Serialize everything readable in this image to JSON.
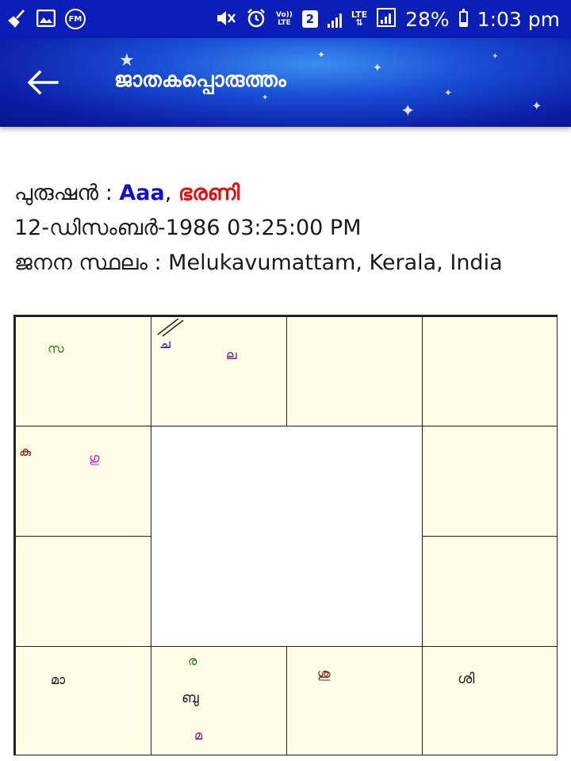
{
  "status_bar": {
    "icons_left": [
      "broom-icon",
      "image-icon",
      "fm-radio-icon"
    ],
    "fm_label": "FM",
    "icons_right": [
      "mute-icon",
      "alarm-icon",
      "volte-icon",
      "sim-icon",
      "signal-icon",
      "lte-icon",
      "signal-icon",
      "battery-icon"
    ],
    "volte_top": "Vo))",
    "volte_bottom": "LTE",
    "sim_number": "2",
    "lte_label": "LTE",
    "battery_percent": "28%",
    "battery_level": 0.28,
    "time": "1:03 pm"
  },
  "app_bar": {
    "back_icon": "arrow-left-icon",
    "title": "ജാതകപ്പൊരുത്തം"
  },
  "profile": {
    "name_label": "പുരുഷൻ : ",
    "name": "Aaa",
    "separator": ", ",
    "star": "ഭരണി",
    "datetime": "12-ഡിസംബർ-1986 03:25:00 PM",
    "birthplace_label": "ജനന സ്ഥലം : ",
    "birthplace": "Melukavumattam, Kerala, India"
  },
  "chart": {
    "cells": {
      "r1c1": [
        {
          "text": "സ",
          "color": "#2e7d32"
        }
      ],
      "r1c2": [
        {
          "text": "ച",
          "color": "#1010d0"
        },
        {
          "text": "ല",
          "color": "#7b1fa2"
        }
      ],
      "r1c3": [],
      "r1c4": [],
      "r2c1": [
        {
          "text": "കു",
          "color": "#8b1a1a"
        },
        {
          "text": "ഗു",
          "color": "#d020c0"
        }
      ],
      "r2c4": [],
      "r3c1": [],
      "r3c4": [],
      "r4c1": [
        {
          "text": "മാ",
          "color": "#222222"
        }
      ],
      "r4c2": [
        {
          "text": "ര",
          "color": "#2e7d32"
        },
        {
          "text": "ബു",
          "color": "#222222"
        },
        {
          "text": "മ",
          "color": "#7b1fa2"
        }
      ],
      "r4c3": [
        {
          "text": "ശു",
          "color": "#8b1a1a"
        }
      ],
      "r4c4": [
        {
          "text": "ശി",
          "color": "#222222"
        }
      ]
    }
  }
}
